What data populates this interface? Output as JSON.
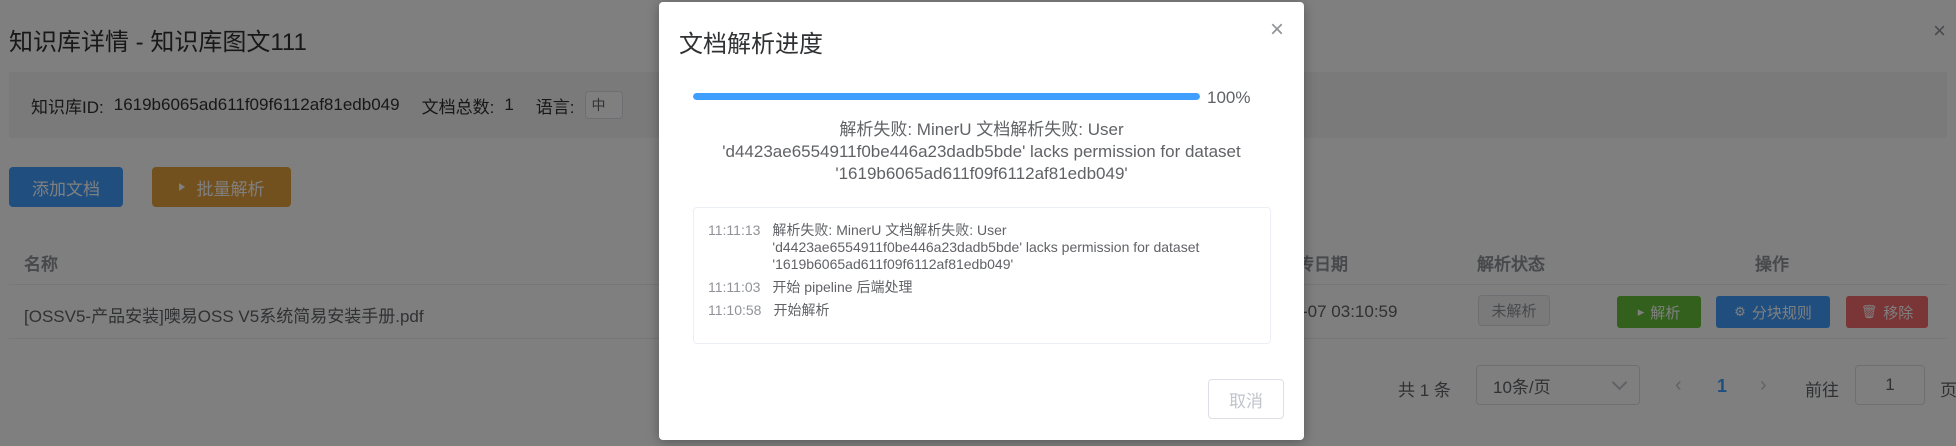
{
  "page": {
    "title": "知识库详情 - 知识库图文111",
    "close_icon": "×"
  },
  "info": {
    "kb_id_label": "知识库ID:",
    "kb_id": "1619b6065ad611f09f6112af81edb049",
    "doc_count_label": "文档总数:",
    "doc_count": "1",
    "language_label": "语言:",
    "language_value": "中"
  },
  "toolbar": {
    "add_label": "添加文档",
    "batch_label": "批量解析"
  },
  "table": {
    "columns": {
      "name": "名称",
      "upload_date": "上传日期",
      "status": "解析状态",
      "actions": "操作"
    },
    "rows": [
      {
        "name": "[OSSV5-产品安装]噢易OSS V5系统简易安装手册.pdf",
        "upload_date": "-07 03:10:59",
        "status": "未解析",
        "parse_label": "解析",
        "rule_label": "分块规则",
        "delete_label": "移除"
      }
    ]
  },
  "pagination": {
    "total": "共 1 条",
    "page_size": "10条/页",
    "current_page": "1",
    "goto_label": "前往",
    "goto_value": "1",
    "goto_unit": "页"
  },
  "dialog": {
    "title": "文档解析进度",
    "close_icon": "×",
    "progress": 100,
    "progress_text": "100%",
    "error_message": "解析失败: MinerU 文档解析失败: User\n'd4423ae6554911f0be446a23dadb5bde' lacks permission for dataset\n'1619b6065ad611f09f6112af81edb049'",
    "logs": [
      {
        "time": "11:11:13",
        "text": "解析失败: MinerU 文档解析失败: User\n'd4423ae6554911f0be446a23dadb5bde' lacks permission for dataset\n'1619b6065ad611f09f6112af81edb049'"
      },
      {
        "time": "11:11:03",
        "text": "开始 pipeline 后端处理"
      },
      {
        "time": "11:10:58",
        "text": "开始解析"
      }
    ],
    "cancel_label": "取消"
  },
  "colors": {
    "primary": "#409eff",
    "warning": "#e6a23c",
    "success": "#67c23a",
    "danger": "#f56c6c"
  }
}
